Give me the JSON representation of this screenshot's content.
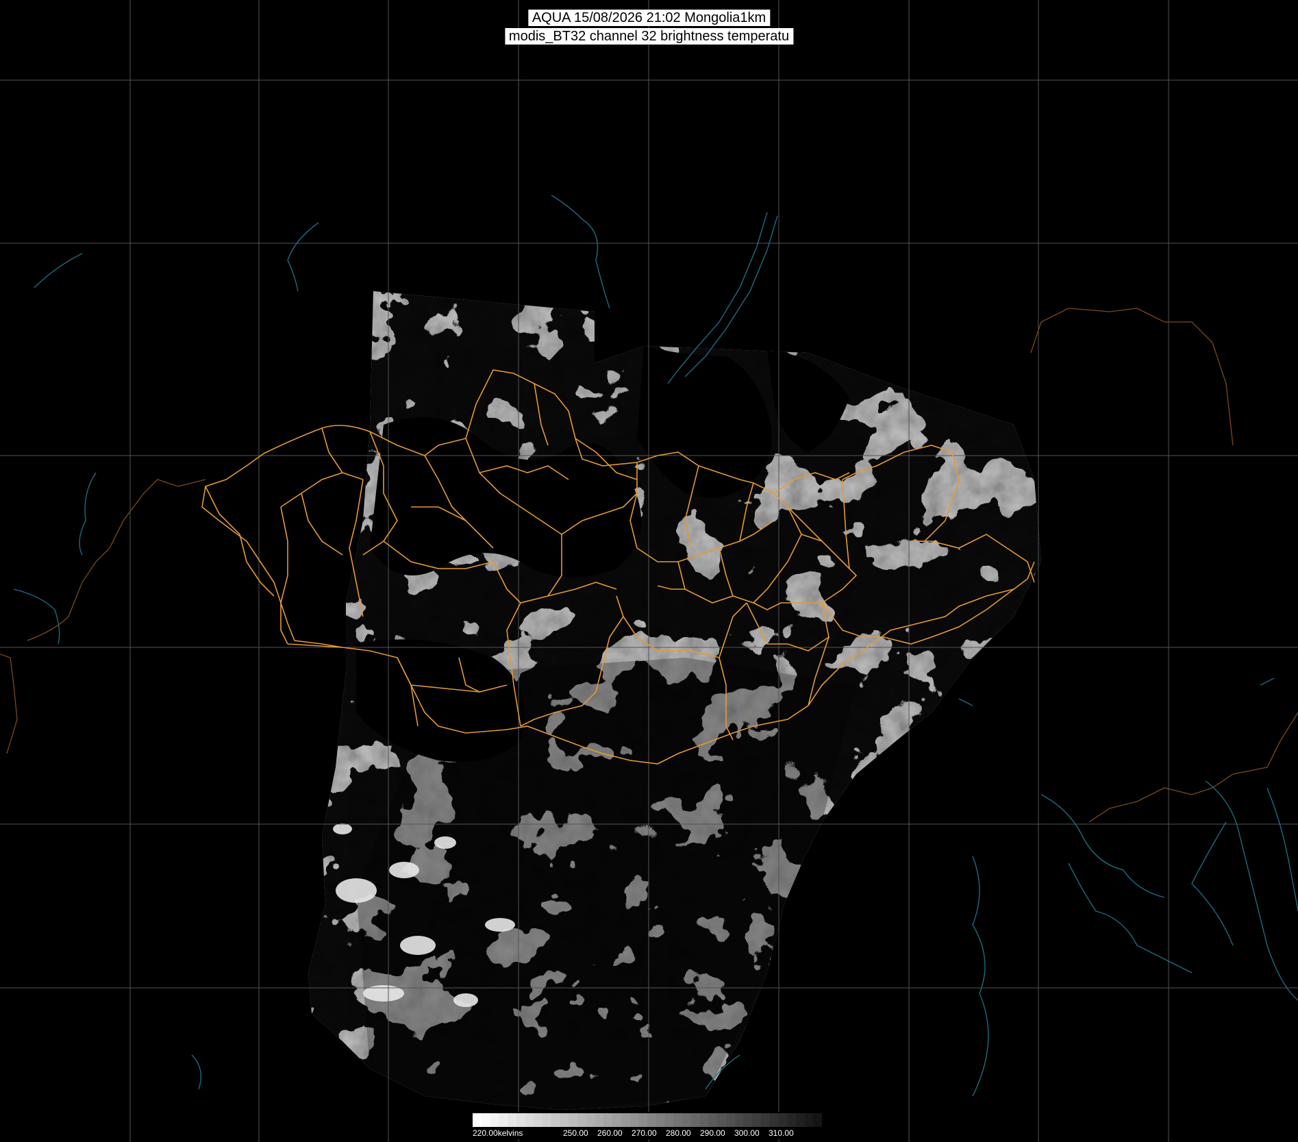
{
  "titles": {
    "line1": "AQUA 15/08/2026 21:02 Mongolia1km",
    "line2": "modis_BT32 channel 32 brightness temperatu"
  },
  "legend": {
    "labels": [
      "220.00kelvins",
      "250.00",
      "260.00",
      "270.00",
      "280.00",
      "290.00",
      "300.00",
      "310.00"
    ]
  },
  "colors": {
    "background": "#000000",
    "grid": "#555555",
    "coastline": "#1e6b80",
    "country_border": "#e59a33",
    "province_border": "#e59a33",
    "foreign_border": "#7a4a1e"
  }
}
